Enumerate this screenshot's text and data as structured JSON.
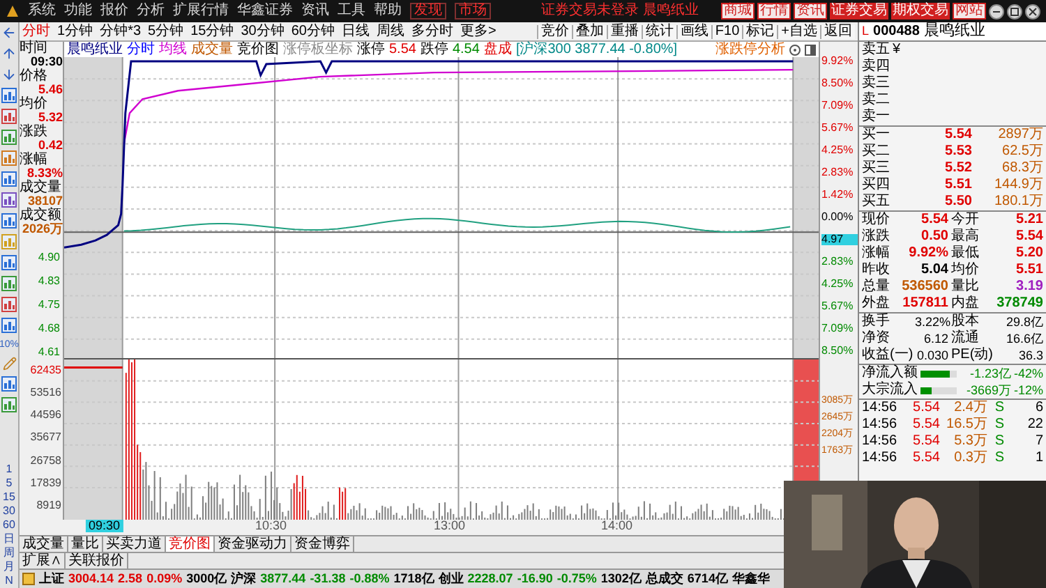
{
  "menu_bar": {
    "items": [
      {
        "label": "系统",
        "highlighted": false
      },
      {
        "label": "功能",
        "highlighted": false
      },
      {
        "label": "报价",
        "highlighted": false
      },
      {
        "label": "分析",
        "highlighted": false
      },
      {
        "label": "扩展行情",
        "highlighted": false
      },
      {
        "label": "华鑫证券",
        "highlighted": false
      },
      {
        "label": "资讯",
        "highlighted": false
      },
      {
        "label": "工具",
        "highlighted": false
      },
      {
        "label": "帮助",
        "highlighted": false
      },
      {
        "label": "发现",
        "highlighted": true
      },
      {
        "label": "市场",
        "highlighted": true
      }
    ],
    "notice": "证券交易未登录 晨鸣纸业",
    "links": [
      {
        "label": "商城",
        "kind": "outline"
      },
      {
        "label": "行情",
        "kind": "outline"
      },
      {
        "label": "资讯",
        "kind": "outline"
      },
      {
        "label": "证券交易",
        "kind": "filled"
      },
      {
        "label": "期权交易",
        "kind": "filled"
      },
      {
        "label": "网站",
        "kind": "outline"
      }
    ]
  },
  "periods": [
    {
      "label": "分时",
      "selected": true
    },
    {
      "label": "1分钟",
      "selected": false
    },
    {
      "label": "分钟*3",
      "selected": false
    },
    {
      "label": "5分钟",
      "selected": false
    },
    {
      "label": "15分钟",
      "selected": false
    },
    {
      "label": "30分钟",
      "selected": false
    },
    {
      "label": "60分钟",
      "selected": false
    },
    {
      "label": "日线",
      "selected": false
    },
    {
      "label": "周线",
      "selected": false
    },
    {
      "label": "多分时",
      "selected": false
    },
    {
      "label": "更多>",
      "selected": false
    }
  ],
  "tools": [
    "竞价",
    "叠加",
    "重播",
    "统计",
    "画线",
    "F10",
    "标记",
    "+自选",
    "返回"
  ],
  "side_percent": "10%",
  "side_shortcuts": [
    "1",
    "5",
    "15",
    "30",
    "60",
    "日",
    "周",
    "月",
    "N"
  ],
  "chart": {
    "legend": [
      {
        "text": "晨鸣纸业",
        "color": "#000080"
      },
      {
        "text": "分时",
        "color": "#0000ff"
      },
      {
        "text": "均线",
        "color": "#d000d0"
      },
      {
        "text": "成交量",
        "color": "#c05800"
      },
      {
        "text": "竞价图",
        "color": "#000000"
      },
      {
        "text": "涨停板坐标",
        "color": "#888888"
      },
      {
        "text": "涨停",
        "color": "#000000"
      },
      {
        "text": "5.54",
        "color": "#e00000"
      },
      {
        "text": "跌停",
        "color": "#000000"
      },
      {
        "text": "4.54",
        "color": "#008a00"
      },
      {
        "text": "盘成",
        "color": "#e00000"
      },
      {
        "text": "[沪深300 3877.44 -0.80%]",
        "color": "#008888"
      }
    ],
    "analysis_link": "涨跌停分析",
    "info": [
      {
        "label": "时间",
        "value": "09:30",
        "color": "#000000"
      },
      {
        "label": "价格",
        "value": "5.46",
        "color": "#e00000"
      },
      {
        "label": "均价",
        "value": "5.32",
        "color": "#e00000"
      },
      {
        "label": "涨跌",
        "value": "0.42",
        "color": "#e00000"
      },
      {
        "label": "涨幅",
        "value": "8.33%",
        "color": "#e00000"
      },
      {
        "label": "成交量",
        "value": "38107",
        "color": "#c05800"
      },
      {
        "label": "成交额",
        "value": "2026万",
        "color": "#c05800"
      }
    ],
    "price_axis": [
      "4.90",
      "4.83",
      "4.75",
      "4.68",
      "4.61"
    ],
    "volume_axis": [
      "62435",
      "53516",
      "44596",
      "35677",
      "26758",
      "17839",
      "8919"
    ],
    "percent_axis_up": [
      "9.92%",
      "8.50%",
      "7.09%",
      "5.67%",
      "4.25%",
      "2.83%",
      "1.42%",
      "0.00%"
    ],
    "current_price": "4.97",
    "percent_axis_down": [
      "2.83%",
      "4.25%",
      "5.67%",
      "7.09%",
      "8.50%"
    ],
    "amount_axis": [
      "3085万",
      "2645万",
      "2204万",
      "1763万"
    ],
    "time_axis": [
      {
        "label": "09:30",
        "selected": true
      },
      {
        "label": "10:30",
        "selected": false
      },
      {
        "label": "13:00",
        "selected": false
      },
      {
        "label": "14:00",
        "selected": false
      }
    ]
  },
  "indicator_tabs": [
    {
      "label": "成交量",
      "selected": false
    },
    {
      "label": "量比",
      "selected": false
    },
    {
      "label": "买卖力道",
      "selected": false
    },
    {
      "label": "竞价图",
      "selected": true
    },
    {
      "label": "资金驱动力",
      "selected": false
    },
    {
      "label": "资金博弈",
      "selected": false
    }
  ],
  "extension_tabs": [
    "扩展∧",
    "关联报价"
  ],
  "quote": {
    "market_tag": "L",
    "code": "000488",
    "name": "晨鸣纸业",
    "sell": [
      {
        "label": "卖五",
        "mark": "¥"
      },
      {
        "label": "卖四"
      },
      {
        "label": "卖三"
      },
      {
        "label": "卖二"
      },
      {
        "label": "卖一"
      }
    ],
    "buy": [
      {
        "label": "买一",
        "price": "5.54",
        "volume": "2897万"
      },
      {
        "label": "买二",
        "price": "5.53",
        "volume": "62.5万"
      },
      {
        "label": "买三",
        "price": "5.52",
        "volume": "68.3万"
      },
      {
        "label": "买四",
        "price": "5.51",
        "volume": "144.9万"
      },
      {
        "label": "买五",
        "price": "5.50",
        "volume": "180.1万"
      }
    ],
    "stats": [
      {
        "left": {
          "label": "现价",
          "value": "5.54",
          "color": "#e00000"
        },
        "right": {
          "label": "今开",
          "value": "5.21",
          "color": "#e00000"
        }
      },
      {
        "left": {
          "label": "涨跌",
          "value": "0.50",
          "color": "#e00000"
        },
        "right": {
          "label": "最高",
          "value": "5.54",
          "color": "#e00000"
        }
      },
      {
        "left": {
          "label": "涨幅",
          "value": "9.92%",
          "color": "#e00000"
        },
        "right": {
          "label": "最低",
          "value": "5.20",
          "color": "#e00000"
        }
      },
      {
        "left": {
          "label": "昨收",
          "value": "5.04",
          "color": "#000000"
        },
        "right": {
          "label": "均价",
          "value": "5.51",
          "color": "#e00000"
        }
      },
      {
        "left": {
          "label": "总量",
          "value": "536560",
          "color": "#c05800"
        },
        "right": {
          "label": "量比",
          "value": "3.19",
          "color": "#a020c0"
        }
      },
      {
        "left": {
          "label": "外盘",
          "value": "157811",
          "color": "#e00000"
        },
        "right": {
          "label": "内盘",
          "value": "378749",
          "color": "#008a00"
        }
      }
    ],
    "fundamentals": [
      {
        "label": "换手",
        "value": "3.22%",
        "label2": "股本",
        "value2": "29.8亿"
      },
      {
        "label": "净资",
        "value": "6.12",
        "label2": "流通",
        "value2": "16.6亿"
      },
      {
        "label": "收益(一)",
        "value": "0.030",
        "label2": "PE(动)",
        "value2": "36.3"
      }
    ],
    "flows": [
      {
        "label": "净流入额",
        "level": 0.8,
        "value": "-1.23亿",
        "pct": "-42%"
      },
      {
        "label": "大宗流入",
        "level": 0.3,
        "value": "-3669万",
        "pct": "-12%"
      }
    ],
    "trades": [
      {
        "time": "14:56",
        "price": "5.54",
        "volume": "2.4万",
        "side": "S",
        "count": "6"
      },
      {
        "time": "14:56",
        "price": "5.54",
        "volume": "16.5万",
        "side": "S",
        "count": "22"
      },
      {
        "time": "14:56",
        "price": "5.54",
        "volume": "5.3万",
        "side": "S",
        "count": "7"
      },
      {
        "time": "14:56",
        "price": "5.54",
        "volume": "0.3万",
        "side": "S",
        "count": "1"
      }
    ]
  },
  "status_bar": [
    {
      "text": "上证",
      "color": "#000000"
    },
    {
      "text": "3004.14",
      "color": "#e00000"
    },
    {
      "text": "2.58",
      "color": "#e00000"
    },
    {
      "text": "0.09%",
      "color": "#e00000"
    },
    {
      "text": "3000亿",
      "color": "#000000"
    },
    {
      "text": "沪深",
      "color": "#000000"
    },
    {
      "text": "3877.44",
      "color": "#008a00"
    },
    {
      "text": "-31.38",
      "color": "#008a00"
    },
    {
      "text": "-0.88%",
      "color": "#008a00"
    },
    {
      "text": "1718亿",
      "color": "#000000"
    },
    {
      "text": "创业",
      "color": "#000000"
    },
    {
      "text": "2228.07",
      "color": "#008a00"
    },
    {
      "text": "-16.90",
      "color": "#008a00"
    },
    {
      "text": "-0.75%",
      "color": "#008a00"
    },
    {
      "text": "1302亿",
      "color": "#000000"
    },
    {
      "text": "总成交",
      "color": "#000000"
    },
    {
      "text": "6714亿",
      "color": "#000000"
    },
    {
      "text": "华鑫华",
      "color": "#000000"
    }
  ],
  "webcam": {
    "kind": "picture"
  }
}
